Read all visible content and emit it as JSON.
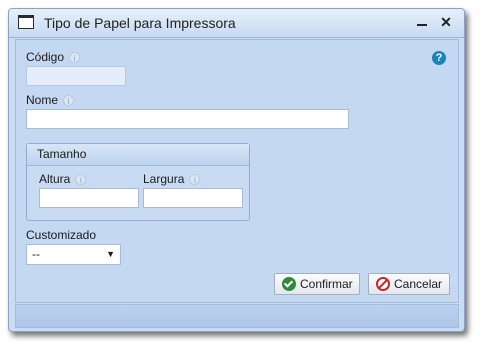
{
  "window": {
    "title": "Tipo de Papel para Impressora",
    "minimize_glyph": "–",
    "close_glyph": "✕"
  },
  "form": {
    "codigo": {
      "label": "Código",
      "value": ""
    },
    "nome": {
      "label": "Nome",
      "value": ""
    },
    "tamanho": {
      "legend": "Tamanho",
      "altura": {
        "label": "Altura",
        "value": ""
      },
      "largura": {
        "label": "Largura",
        "value": ""
      }
    },
    "customizado": {
      "label": "Customizado",
      "selected": "--"
    },
    "info_glyph": "i",
    "help_glyph": "?"
  },
  "buttons": {
    "confirm_label": "Confirmar",
    "cancel_label": "Cancelar"
  },
  "icons": {
    "window": "window-icon",
    "minimize": "minimize-icon",
    "close": "close-icon",
    "help": "help-icon",
    "info": "info-icon",
    "confirm": "check-circle-icon",
    "cancel": "cancel-circle-icon",
    "dropdown": "chevron-down-icon"
  },
  "colors": {
    "window_bg": "#c8dcf3",
    "help_icon": "#1985b8",
    "confirm_icon": "#2f8a3a",
    "cancel_icon": "#c0272d"
  }
}
